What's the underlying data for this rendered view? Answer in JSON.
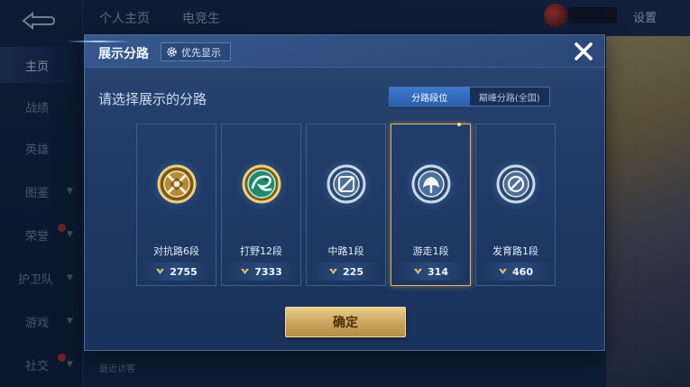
{
  "background": {
    "nav_items": [
      {
        "label": "主页",
        "active": true
      },
      {
        "label": "战绩"
      },
      {
        "label": "英雄"
      },
      {
        "label": "图鉴"
      },
      {
        "label": "荣誉"
      },
      {
        "label": "护卫队"
      },
      {
        "label": "游戏"
      },
      {
        "label": "社交"
      }
    ],
    "top_tabs": [
      "个人主页",
      "电竞生"
    ],
    "settings_label": "设置",
    "visitors_label": "最近访客"
  },
  "modal": {
    "title": "展示分路",
    "priority_label": "优先显示",
    "subtitle": "请选择展示的分路",
    "segments": [
      {
        "label": "分路段位",
        "active": true
      },
      {
        "label": "巅峰分路(全国)",
        "active": false
      }
    ],
    "cards": [
      {
        "rank": "对抗路6段",
        "score": "2755",
        "badge": "gold-sword",
        "selected": false
      },
      {
        "rank": "打野12段",
        "score": "7333",
        "badge": "jade-dragon",
        "selected": false
      },
      {
        "rank": "中路1段",
        "score": "225",
        "badge": "silver-staff",
        "selected": false
      },
      {
        "rank": "游走1段",
        "score": "314",
        "badge": "silver-wings",
        "selected": true
      },
      {
        "rank": "发育路1段",
        "score": "460",
        "badge": "silver-eye",
        "selected": false
      }
    ],
    "confirm_label": "确定"
  },
  "colors": {
    "accent_gold": "#e6b15f",
    "segment_active": "#3c7ad0"
  }
}
